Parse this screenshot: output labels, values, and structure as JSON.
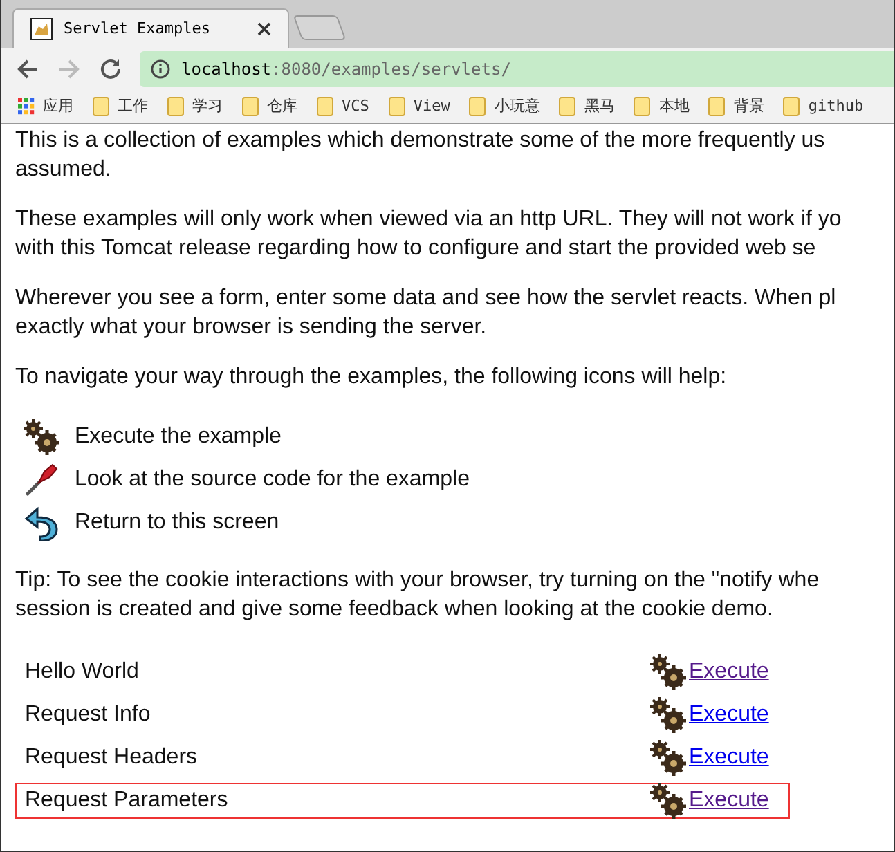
{
  "tabs": [
    {
      "title": "Servlet Examples",
      "selected": true
    },
    {
      "selected": false
    }
  ],
  "address": {
    "host": "localhost",
    "rest": ":8080/examples/servlets/"
  },
  "bookmarks": [
    {
      "label": "应用",
      "kind": "apps"
    },
    {
      "label": "工作",
      "kind": "folder"
    },
    {
      "label": "学习",
      "kind": "folder"
    },
    {
      "label": "仓库",
      "kind": "folder"
    },
    {
      "label": "VCS",
      "kind": "folder"
    },
    {
      "label": "View",
      "kind": "folder"
    },
    {
      "label": "小玩意",
      "kind": "folder"
    },
    {
      "label": "黑马",
      "kind": "folder"
    },
    {
      "label": "本地",
      "kind": "folder"
    },
    {
      "label": "背景",
      "kind": "folder"
    },
    {
      "label": "github",
      "kind": "folder"
    }
  ],
  "paragraphs": [
    [
      "This is a collection of examples which demonstrate some of the more frequently us",
      "assumed."
    ],
    [
      "These examples will only work when viewed via an http URL. They will not work if yo",
      "with this Tomcat release regarding how to configure and start the provided web se"
    ],
    [
      "Wherever you see a form, enter some data and see how the servlet reacts. When pl",
      "exactly what your browser is sending the server."
    ],
    [
      "To navigate your way through the examples, the following icons will help:"
    ]
  ],
  "legend": [
    {
      "kind": "execute",
      "text": "Execute the example"
    },
    {
      "kind": "source",
      "text": "Look at the source code for the example"
    },
    {
      "kind": "return",
      "text": "Return to this screen"
    }
  ],
  "tip": [
    "Tip: To see the cookie interactions with your browser, try turning on the \"notify whe",
    "session is created and give some feedback when looking at the cookie demo."
  ],
  "examples": [
    {
      "name": "Hello World",
      "link": "Execute",
      "visited": true,
      "highlighted": false
    },
    {
      "name": "Request Info",
      "link": "Execute",
      "visited": false,
      "highlighted": false
    },
    {
      "name": "Request Headers",
      "link": "Execute",
      "visited": false,
      "highlighted": false
    },
    {
      "name": "Request Parameters",
      "link": "Execute",
      "visited": true,
      "highlighted": true
    }
  ]
}
